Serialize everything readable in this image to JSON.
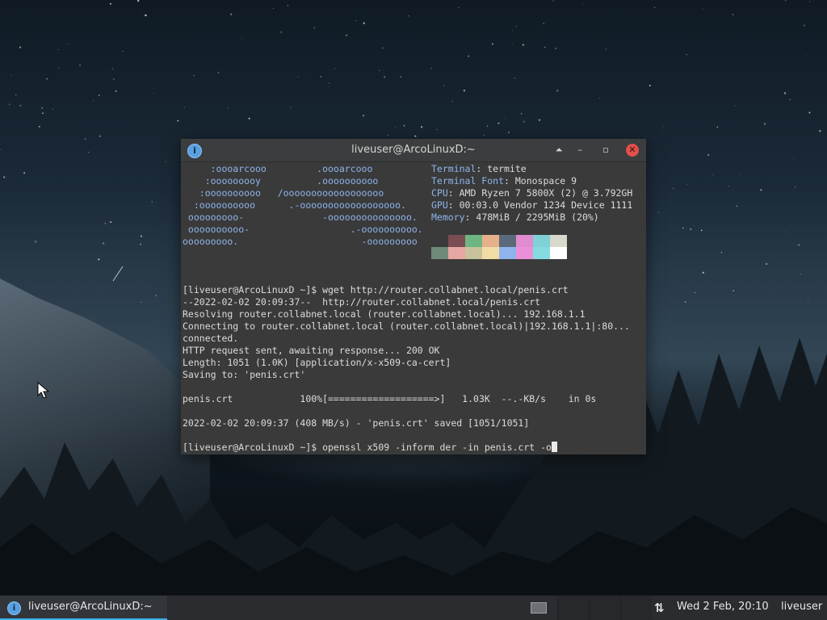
{
  "window": {
    "title": "liveuser@ArcoLinuxD:~",
    "buttons": {
      "keep_above": "⏶",
      "minimize": "–",
      "maximize": "▫",
      "close": "✕"
    }
  },
  "neofetch": {
    "logo": [
      "     :oooarcooo         .oooarcooo",
      "    :ooooooooy          .oooooooooo",
      "   :oooooooooo   /oooooooooooooooooo",
      "  :oooooooooo      .-oooooooooooooooooo.",
      " ooooooooo-              -ooooooooooooooo.",
      " oooooooooo-                  .-oooooooooo.",
      "ooooooooo.                      -ooooooooo"
    ],
    "info": [
      {
        "key": "Terminal",
        "value": ": termite"
      },
      {
        "key": "Terminal Font",
        "value": ": Monospace 9"
      },
      {
        "key": "CPU",
        "value": ": AMD Ryzen 7 5800X (2) @ 3.792GH"
      },
      {
        "key": "GPU",
        "value": ": 00:03.0 Vendor 1234 Device 1111"
      },
      {
        "key": "Memory",
        "value": ": 478MiB / 2295MiB (20%)"
      }
    ],
    "palette_top": [
      "#3a3a3a",
      "#7b4c52",
      "#6eb582",
      "#e6b08a",
      "#5a6a7a",
      "#e18bd0",
      "#7fd1d6",
      "#d8d8cc"
    ],
    "palette_bottom": [
      "#6f8a78",
      "#e6a6a2",
      "#c8c29c",
      "#f0dca4",
      "#8fb4ec",
      "#ea90d8",
      "#86dbe0",
      "#ffffff"
    ]
  },
  "terminal_output": [
    "[liveuser@ArcoLinuxD ~]$ wget http://router.collabnet.local/penis.crt",
    "--2022-02-02 20:09:37--  http://router.collabnet.local/penis.crt",
    "Resolving router.collabnet.local (router.collabnet.local)... 192.168.1.1",
    "Connecting to router.collabnet.local (router.collabnet.local)|192.168.1.1|:80...",
    "connected.",
    "HTTP request sent, awaiting response... 200 OK",
    "Length: 1051 (1.0K) [application/x-x509-ca-cert]",
    "Saving to: 'penis.crt'",
    "",
    "penis.crt            100%[===================>]   1.03K  --.-KB/s    in 0s",
    "",
    "2022-02-02 20:09:37 (408 MB/s) - 'penis.crt' saved [1051/1051]",
    ""
  ],
  "prompt_line": "[liveuser@ArcoLinuxD ~]$ openssl x509 -inform der -in penis.crt -o",
  "taskbar": {
    "task_label": "liveuser@ArcoLinuxD:~",
    "clock": "Wed  2 Feb, 20:10",
    "user": "liveuser",
    "network_icon": "⇅"
  },
  "icons": {
    "app_icon": "i"
  }
}
